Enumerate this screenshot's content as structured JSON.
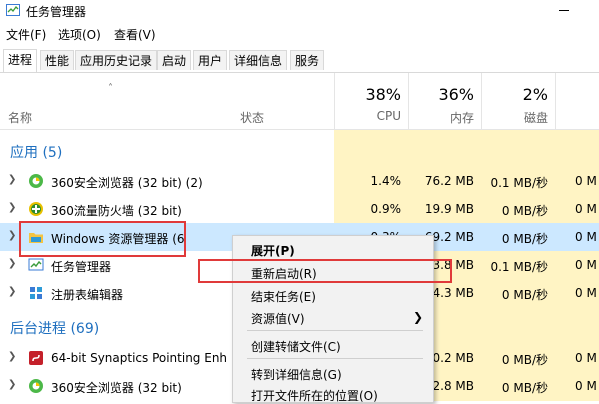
{
  "window": {
    "title": "任务管理器"
  },
  "menu": [
    "文件(F)",
    "选项(O)",
    "查看(V)"
  ],
  "tabs": [
    "进程",
    "性能",
    "应用历史记录",
    "启动",
    "用户",
    "详细信息",
    "服务"
  ],
  "header": {
    "name": "名称",
    "status": "状态",
    "columns": [
      {
        "pct": "38%",
        "label": "CPU"
      },
      {
        "pct": "36%",
        "label": "内存"
      },
      {
        "pct": "2%",
        "label": "磁盘"
      },
      {
        "pct": "",
        "label": ""
      }
    ]
  },
  "sections": {
    "apps": "应用 (5)",
    "background": "后台进程 (69)"
  },
  "apps": [
    {
      "name": "360安全浏览器 (32 bit) (2)",
      "cpu": "1.4%",
      "mem": "76.2 MB",
      "disk": "0.1 MB/秒",
      "net": "0 M",
      "icon": "browser-icon"
    },
    {
      "name": "360流量防火墙 (32 bit)",
      "cpu": "0.9%",
      "mem": "19.9 MB",
      "disk": "0 MB/秒",
      "net": "0 M",
      "icon": "firewall-icon"
    },
    {
      "name": "Windows 资源管理器 (6",
      "cpu": "0.3%",
      "mem": "69.2 MB",
      "disk": "0 MB/秒",
      "net": "0 M",
      "icon": "folder-icon"
    },
    {
      "name": "任务管理器",
      "cpu": "",
      "mem": "3.8 MB",
      "disk": "0.1 MB/秒",
      "net": "0 M",
      "icon": "taskmgr-icon"
    },
    {
      "name": "注册表编辑器",
      "cpu": "",
      "mem": "4.3 MB",
      "disk": "0 MB/秒",
      "net": "0 M",
      "icon": "regedit-icon"
    }
  ],
  "background": [
    {
      "name": "64-bit Synaptics Pointing Enh",
      "cpu": "",
      "mem": "0.2 MB",
      "disk": "0 MB/秒",
      "net": "0 M",
      "icon": "synaptics-icon"
    },
    {
      "name": "360安全浏览器 (32 bit)",
      "cpu": "",
      "mem": "2.8 MB",
      "disk": "0 MB/秒",
      "net": "0 M",
      "icon": "browser-icon"
    }
  ],
  "context_menu": {
    "expand": "展开(P)",
    "restart": "重新启动(R)",
    "end_task": "结束任务(E)",
    "resource_values": "资源值(V)",
    "create_dump": "创建转储文件(C)",
    "go_details": "转到详细信息(G)",
    "open_location": "打开文件所在的位置(O)"
  },
  "colors": {
    "accent": "#1e6fbf",
    "highlight": "#fff4c4",
    "selected": "#cce8ff",
    "annotation": "#e03a3a"
  }
}
